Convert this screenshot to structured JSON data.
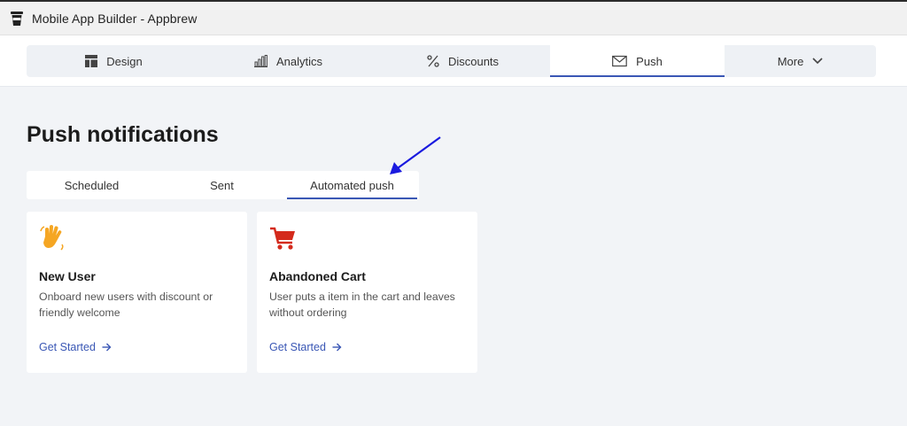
{
  "window": {
    "title": "Mobile App Builder - Appbrew",
    "icon": "app-cup-icon"
  },
  "nav": {
    "items": [
      {
        "label": "Design",
        "icon": "layout-icon"
      },
      {
        "label": "Analytics",
        "icon": "bar-chart-icon"
      },
      {
        "label": "Discounts",
        "icon": "percent-icon"
      },
      {
        "label": "Push",
        "icon": "envelope-icon",
        "active": true
      },
      {
        "label": "More",
        "icon": "chevron-down-icon"
      }
    ]
  },
  "page": {
    "title": "Push notifications"
  },
  "subtabs": [
    {
      "label": "Scheduled"
    },
    {
      "label": "Sent"
    },
    {
      "label": "Automated push",
      "active": true
    }
  ],
  "cards": [
    {
      "icon": "waving-hands-icon",
      "title": "New User",
      "description": "Onboard new users with discount or friendly welcome",
      "cta": "Get Started"
    },
    {
      "icon": "shopping-cart-icon",
      "title": "Abandoned Cart",
      "description": "User puts a item in the cart and leaves without ordering",
      "cta": "Get Started"
    }
  ],
  "colors": {
    "accent": "#3a57b5",
    "background": "#f2f4f7",
    "annotation_arrow": "#1a1adf",
    "cart_red": "#d42a1c",
    "hands_orange": "#f5a623"
  }
}
